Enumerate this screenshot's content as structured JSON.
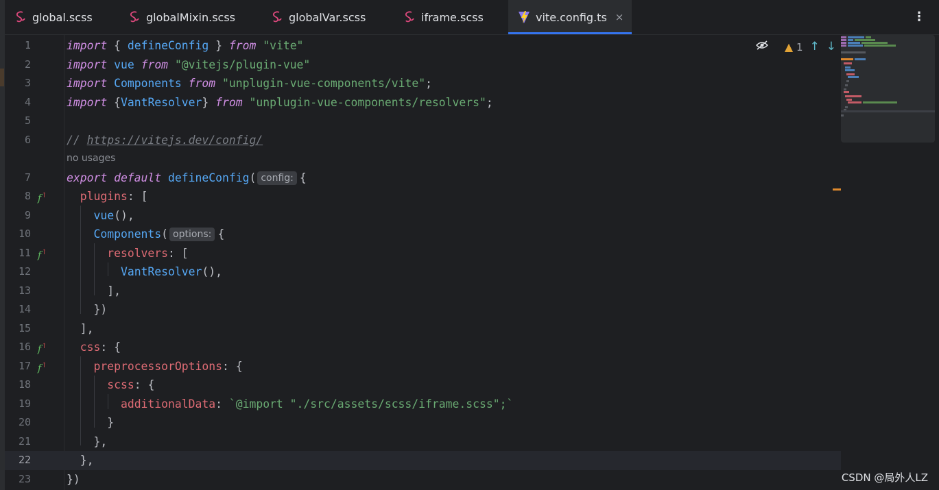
{
  "tabs": [
    {
      "label": "global.scss",
      "icon": "sass-icon",
      "active": false
    },
    {
      "label": "globalMixin.scss",
      "icon": "sass-icon",
      "active": false
    },
    {
      "label": "globalVar.scss",
      "icon": "sass-icon",
      "active": false
    },
    {
      "label": "iframe.scss",
      "icon": "sass-icon",
      "active": false
    },
    {
      "label": "vite.config.ts",
      "icon": "vite-icon",
      "active": true
    }
  ],
  "tab_close_glyph": "×",
  "toolbar": {
    "warning_count": "1"
  },
  "code": {
    "usage_hint": "no usages",
    "hint_config": "config:",
    "hint_options": "options:",
    "line_numbers": [
      "1",
      "2",
      "3",
      "4",
      "5",
      "6",
      "7",
      "8",
      "9",
      "10",
      "11",
      "12",
      "13",
      "14",
      "15",
      "16",
      "17",
      "18",
      "19",
      "20",
      "21",
      "22",
      "23"
    ],
    "lines": [
      "import { defineConfig } from \"vite\"",
      "import vue from \"@vitejs/plugin-vue\"",
      "import Components from \"unplugin-vue-components/vite\";",
      "import {VantResolver} from \"unplugin-vue-components/resolvers\";",
      "",
      "// https://vitejs.dev/config/",
      "export default defineConfig( config: {",
      "  plugins: [",
      "    vue(),",
      "    Components( options: {",
      "      resolvers: [",
      "        VantResolver(),",
      "      ],",
      "    })",
      "  ],",
      "  css: {",
      "    preprocessorOptions: {",
      "      scss: {",
      "        additionalData: `@import \"./src/assets/scss/iframe.scss\";`",
      "      }",
      "    },",
      "  },",
      "})"
    ]
  },
  "watermark": "CSDN @局外人LZ",
  "colors": {
    "keyword": "#cf8ee3",
    "identifier": "#56a8f5",
    "string": "#6aab73",
    "property": "#e06c75",
    "accent": "#3574f0"
  }
}
